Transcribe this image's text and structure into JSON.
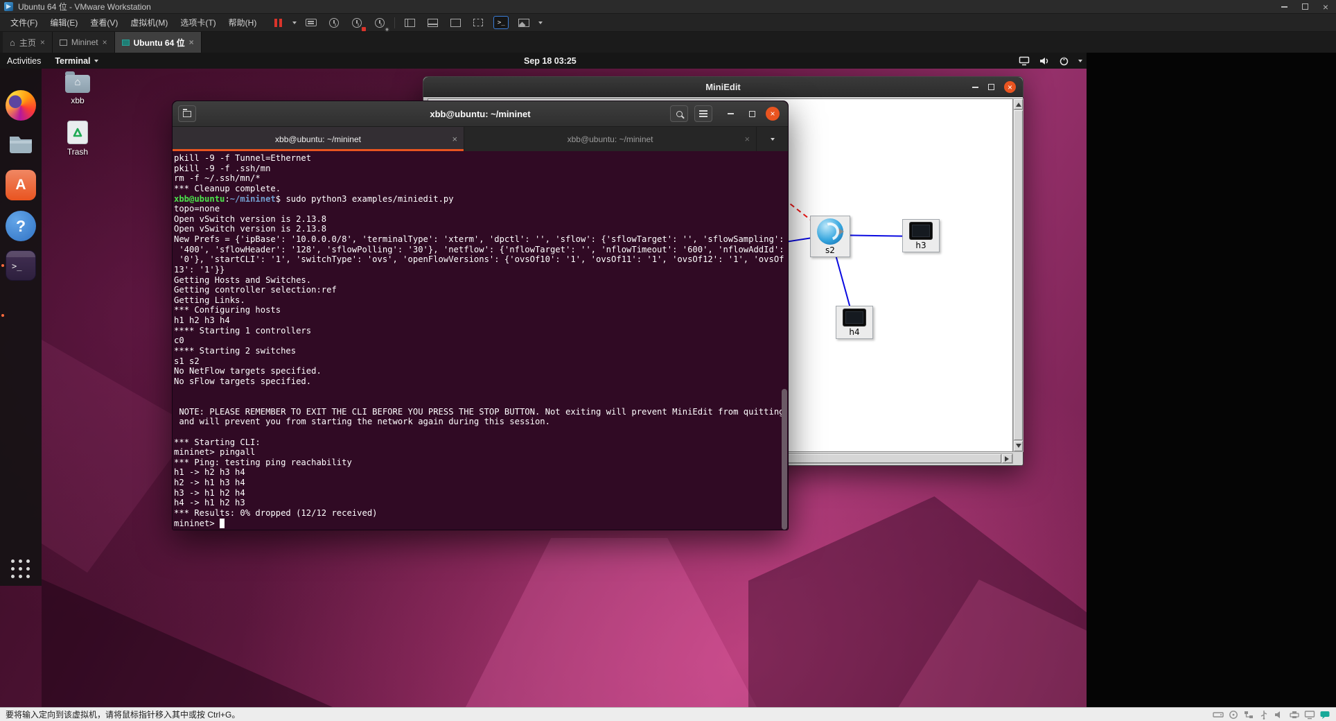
{
  "colors": {
    "accent": "#e95420",
    "term-bg": "#300a24",
    "term-fg": "#ffffff",
    "term-green": "#4ce44c",
    "term-blue": "#729fcf",
    "link-blue": "#0a0ae0",
    "link-red": "#f21616"
  },
  "vmware": {
    "title": "Ubuntu 64 位 - VMware Workstation",
    "menus": [
      "文件(F)",
      "编辑(E)",
      "查看(V)",
      "虚拟机(M)",
      "选项卡(T)",
      "帮助(H)"
    ],
    "tabs": [
      {
        "label": "主页"
      },
      {
        "label": "Mininet"
      },
      {
        "label": "Ubuntu 64 位"
      }
    ],
    "status_hint": "要将输入定向到该虚拟机，请将鼠标指针移入其中或按 Ctrl+G。"
  },
  "ubuntu": {
    "activities": "Activities",
    "focused_app": "Terminal",
    "clock": "Sep 18 03:25",
    "desktop_icons": [
      {
        "label": "xbb"
      },
      {
        "label": "Trash"
      }
    ]
  },
  "miniedit": {
    "title": "MiniEdit",
    "nodes": [
      {
        "id": "s2",
        "type": "switch",
        "label": "s2"
      },
      {
        "id": "h3",
        "type": "host",
        "label": "h3"
      },
      {
        "id": "h4",
        "type": "host",
        "label": "h4"
      }
    ],
    "links": [
      {
        "a": "s2",
        "b": "h3",
        "color": "blue",
        "style": "solid"
      },
      {
        "a": "s2",
        "b": "h4",
        "color": "blue",
        "style": "solid"
      },
      {
        "a": "offscreen",
        "b": "s2",
        "color": "blue",
        "style": "solid"
      },
      {
        "a": "offscreen",
        "b": "s2",
        "color": "red",
        "style": "dashed"
      }
    ]
  },
  "terminal": {
    "title": "xbb@ubuntu: ~/mininet",
    "tabs": [
      "xbb@ubuntu: ~/mininet",
      "xbb@ubuntu: ~/mininet"
    ],
    "lines": [
      [
        {
          "t": "pkill -9 -f Tunnel=Ethernet"
        }
      ],
      [
        {
          "t": "pkill -9 -f .ssh/mn"
        }
      ],
      [
        {
          "t": "rm -f ~/.ssh/mn/*"
        }
      ],
      [
        {
          "t": "*** Cleanup complete."
        }
      ],
      [
        {
          "t": "xbb@ubuntu",
          "c": "green"
        },
        {
          "t": ":"
        },
        {
          "t": "~/mininet",
          "c": "blue"
        },
        {
          "t": "$ sudo python3 examples/miniedit.py"
        }
      ],
      [
        {
          "t": "topo=none"
        }
      ],
      [
        {
          "t": "Open vSwitch version is 2.13.8"
        }
      ],
      [
        {
          "t": "Open vSwitch version is 2.13.8"
        }
      ],
      [
        {
          "t": "New Prefs = {'ipBase': '10.0.0.0/8', 'terminalType': 'xterm', 'dpctl': '', 'sflow': {'sflowTarget': '', 'sflowSampling':"
        }
      ],
      [
        {
          "t": " '400', 'sflowHeader': '128', 'sflowPolling': '30'}, 'netflow': {'nflowTarget': '', 'nflowTimeout': '600', 'nflowAddId':"
        }
      ],
      [
        {
          "t": " '0'}, 'startCLI': '1', 'switchType': 'ovs', 'openFlowVersions': {'ovsOf10': '1', 'ovsOf11': '1', 'ovsOf12': '1', 'ovsOf"
        }
      ],
      [
        {
          "t": "13': '1'}}"
        }
      ],
      [
        {
          "t": "Getting Hosts and Switches."
        }
      ],
      [
        {
          "t": "Getting controller selection:ref"
        }
      ],
      [
        {
          "t": "Getting Links."
        }
      ],
      [
        {
          "t": "*** Configuring hosts"
        }
      ],
      [
        {
          "t": "h1 h2 h3 h4"
        }
      ],
      [
        {
          "t": "**** Starting 1 controllers"
        }
      ],
      [
        {
          "t": "c0"
        }
      ],
      [
        {
          "t": "**** Starting 2 switches"
        }
      ],
      [
        {
          "t": "s1 s2"
        }
      ],
      [
        {
          "t": "No NetFlow targets specified."
        }
      ],
      [
        {
          "t": "No sFlow targets specified."
        }
      ],
      [],
      [],
      [
        {
          "t": " NOTE: PLEASE REMEMBER TO EXIT THE CLI BEFORE YOU PRESS THE STOP BUTTON. Not exiting will prevent MiniEdit from quitting"
        }
      ],
      [
        {
          "t": " and will prevent you from starting the network again during this session."
        }
      ],
      [],
      [
        {
          "t": "*** Starting CLI:"
        }
      ],
      [
        {
          "t": "mininet> pingall"
        }
      ],
      [
        {
          "t": "*** Ping: testing ping reachability"
        }
      ],
      [
        {
          "t": "h1 -> h2 h3 h4"
        }
      ],
      [
        {
          "t": "h2 -> h1 h3 h4"
        }
      ],
      [
        {
          "t": "h3 -> h1 h2 h4"
        }
      ],
      [
        {
          "t": "h4 -> h1 h2 h3"
        }
      ],
      [
        {
          "t": "*** Results: 0% dropped (12/12 received)"
        }
      ],
      [
        {
          "t": "mininet> "
        },
        {
          "t": " ",
          "c": "cursor"
        }
      ]
    ]
  }
}
